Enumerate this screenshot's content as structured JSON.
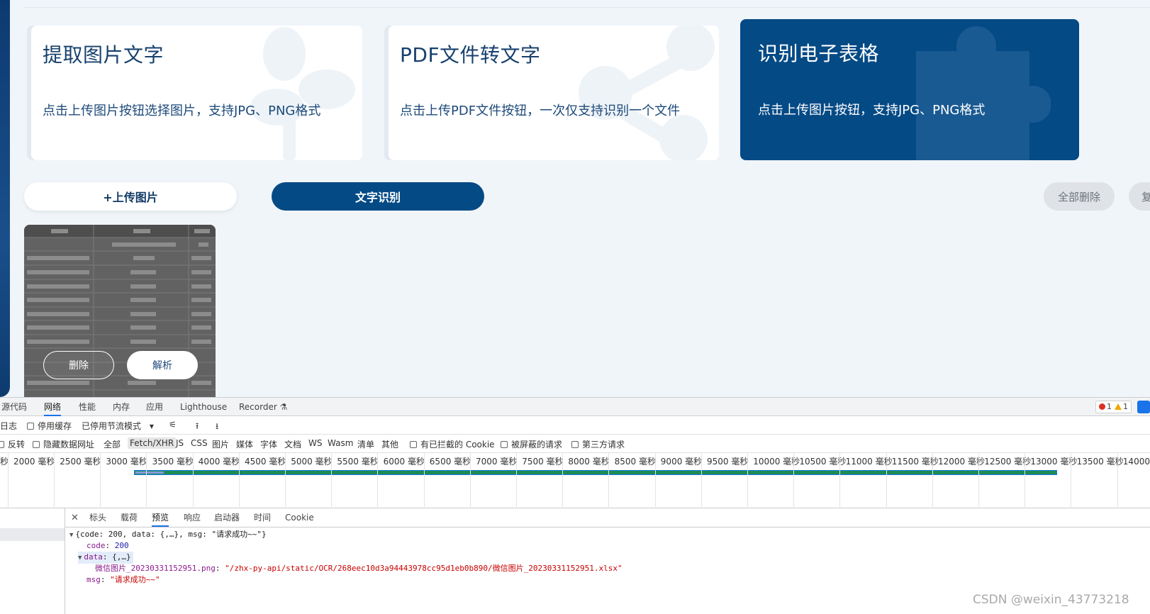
{
  "cards": [
    {
      "title": "提取图片文字",
      "desc": "点击上传图片按钮选择图片，支持JPG、PNG格式"
    },
    {
      "title": "PDF文件转文字",
      "desc": "点击上传PDF文件按钮，一次仅支持识别一个文件"
    },
    {
      "title": "识别电子表格",
      "desc": "点击上传图片按钮，支持JPG、PNG格式"
    }
  ],
  "actions": {
    "upload": "+上传图片",
    "ocr": "文字识别",
    "delete_all": "全部删除",
    "copy": "复"
  },
  "thumbnail": {
    "delete": "删除",
    "parse": "解析"
  },
  "devtools": {
    "tabs": [
      "源代码",
      "网络",
      "性能",
      "内存",
      "应用",
      "Lighthouse",
      "Recorder"
    ],
    "error_count": "1",
    "warning_count": "1",
    "toolbar": {
      "log": "日志",
      "disable_cache": "停用缓存",
      "throttle": "已停用节流模式"
    },
    "filters": {
      "invert": "反转",
      "hide_data_url": "隐藏数据网址",
      "types": [
        "全部",
        "Fetch/XHR",
        "JS",
        "CSS",
        "图片",
        "媒体",
        "字体",
        "文档",
        "WS",
        "Wasm",
        "清单",
        "其他"
      ],
      "blocked_cookies": "有已拦截的 Cookie",
      "blocked_requests": "被屏蔽的请求",
      "third_party": "第三方请求"
    },
    "timeline_ticks": [
      "秒",
      "2000 毫秒",
      "2500 毫秒",
      "3000 毫秒",
      "3500 毫秒",
      "4000 毫秒",
      "4500 毫秒",
      "5000 毫秒",
      "5500 毫秒",
      "6000 毫秒",
      "6500 毫秒",
      "7000 毫秒",
      "7500 毫秒",
      "8000 毫秒",
      "8500 毫秒",
      "9000 毫秒",
      "9500 毫秒",
      "10000 毫秒",
      "10500 毫秒",
      "11000 毫秒",
      "11500 毫秒",
      "12000 毫秒",
      "12500 毫秒",
      "13000 毫秒",
      "13500 毫秒",
      "14000 毫"
    ],
    "detail_tabs": [
      "标头",
      "载荷",
      "预览",
      "响应",
      "启动器",
      "时间",
      "Cookie"
    ],
    "preview": {
      "summary": "{code: 200, data: {,…}, msg: \"请求成功~~\"}",
      "code_key": "code",
      "code_val": "200",
      "data_key": "data",
      "data_val": "{,…}",
      "file_key": "微信图片_20230331152951.png",
      "file_val": "\"/zhx-py-api/static/OCR/268eec10d3a94443978cc95d1eb0b890/微信图片_20230331152951.xlsx\"",
      "msg_key": "msg",
      "msg_val": "\"请求成功~~\""
    }
  },
  "watermark": "CSDN @weixin_43773218",
  "colors": {
    "brand": "#044a85",
    "page_bg": "#f0f5fa"
  }
}
